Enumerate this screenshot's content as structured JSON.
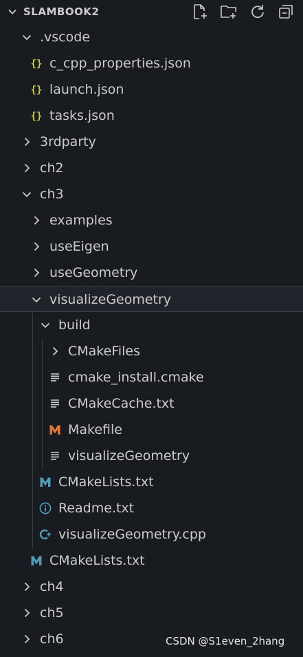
{
  "explorer": {
    "title": "SLAMBOOK2",
    "actions": [
      {
        "name": "new-file-icon"
      },
      {
        "name": "new-folder-icon"
      },
      {
        "name": "refresh-icon"
      },
      {
        "name": "collapse-all-icon"
      }
    ]
  },
  "tree": [
    {
      "label": ".vscode",
      "kind": "folder",
      "expanded": true,
      "depth": 1
    },
    {
      "label": "c_cpp_properties.json",
      "kind": "json",
      "depth": 2
    },
    {
      "label": "launch.json",
      "kind": "json",
      "depth": 2
    },
    {
      "label": "tasks.json",
      "kind": "json",
      "depth": 2
    },
    {
      "label": "3rdparty",
      "kind": "folder",
      "expanded": false,
      "depth": 1
    },
    {
      "label": "ch2",
      "kind": "folder",
      "expanded": false,
      "depth": 1
    },
    {
      "label": "ch3",
      "kind": "folder",
      "expanded": true,
      "depth": 1
    },
    {
      "label": "examples",
      "kind": "folder",
      "expanded": false,
      "depth": 2
    },
    {
      "label": "useEigen",
      "kind": "folder",
      "expanded": false,
      "depth": 2
    },
    {
      "label": "useGeometry",
      "kind": "folder",
      "expanded": false,
      "depth": 2
    },
    {
      "label": "visualizeGeometry",
      "kind": "folder",
      "expanded": true,
      "depth": 2,
      "selected": true
    },
    {
      "label": "build",
      "kind": "folder",
      "expanded": true,
      "depth": 3
    },
    {
      "label": "CMakeFiles",
      "kind": "folder",
      "expanded": false,
      "depth": 4
    },
    {
      "label": "cmake_install.cmake",
      "kind": "text",
      "depth": 4
    },
    {
      "label": "CMakeCache.txt",
      "kind": "text",
      "depth": 4
    },
    {
      "label": "Makefile",
      "kind": "makefile",
      "depth": 4
    },
    {
      "label": "visualizeGeometry",
      "kind": "text",
      "depth": 4
    },
    {
      "label": "CMakeLists.txt",
      "kind": "cmakelists",
      "depth": 3
    },
    {
      "label": "Readme.txt",
      "kind": "info",
      "depth": 3
    },
    {
      "label": "visualizeGeometry.cpp",
      "kind": "cpp",
      "depth": 3
    },
    {
      "label": "CMakeLists.txt",
      "kind": "cmakelists",
      "depth": 2
    },
    {
      "label": "ch4",
      "kind": "folder",
      "expanded": false,
      "depth": 1
    },
    {
      "label": "ch5",
      "kind": "folder",
      "expanded": false,
      "depth": 1
    },
    {
      "label": "ch6",
      "kind": "folder",
      "expanded": false,
      "depth": 1
    }
  ],
  "watermark": "CSDN @S1even_2hang",
  "colors": {
    "background": "#181b20",
    "text": "#cccccc",
    "json_icon": "#cbcb41",
    "makefile_icon": "#e37933",
    "cmakelists_icon": "#519aba",
    "info_icon": "#519aba",
    "cpp_icon": "#519aba",
    "selected_row": "#20232a"
  }
}
